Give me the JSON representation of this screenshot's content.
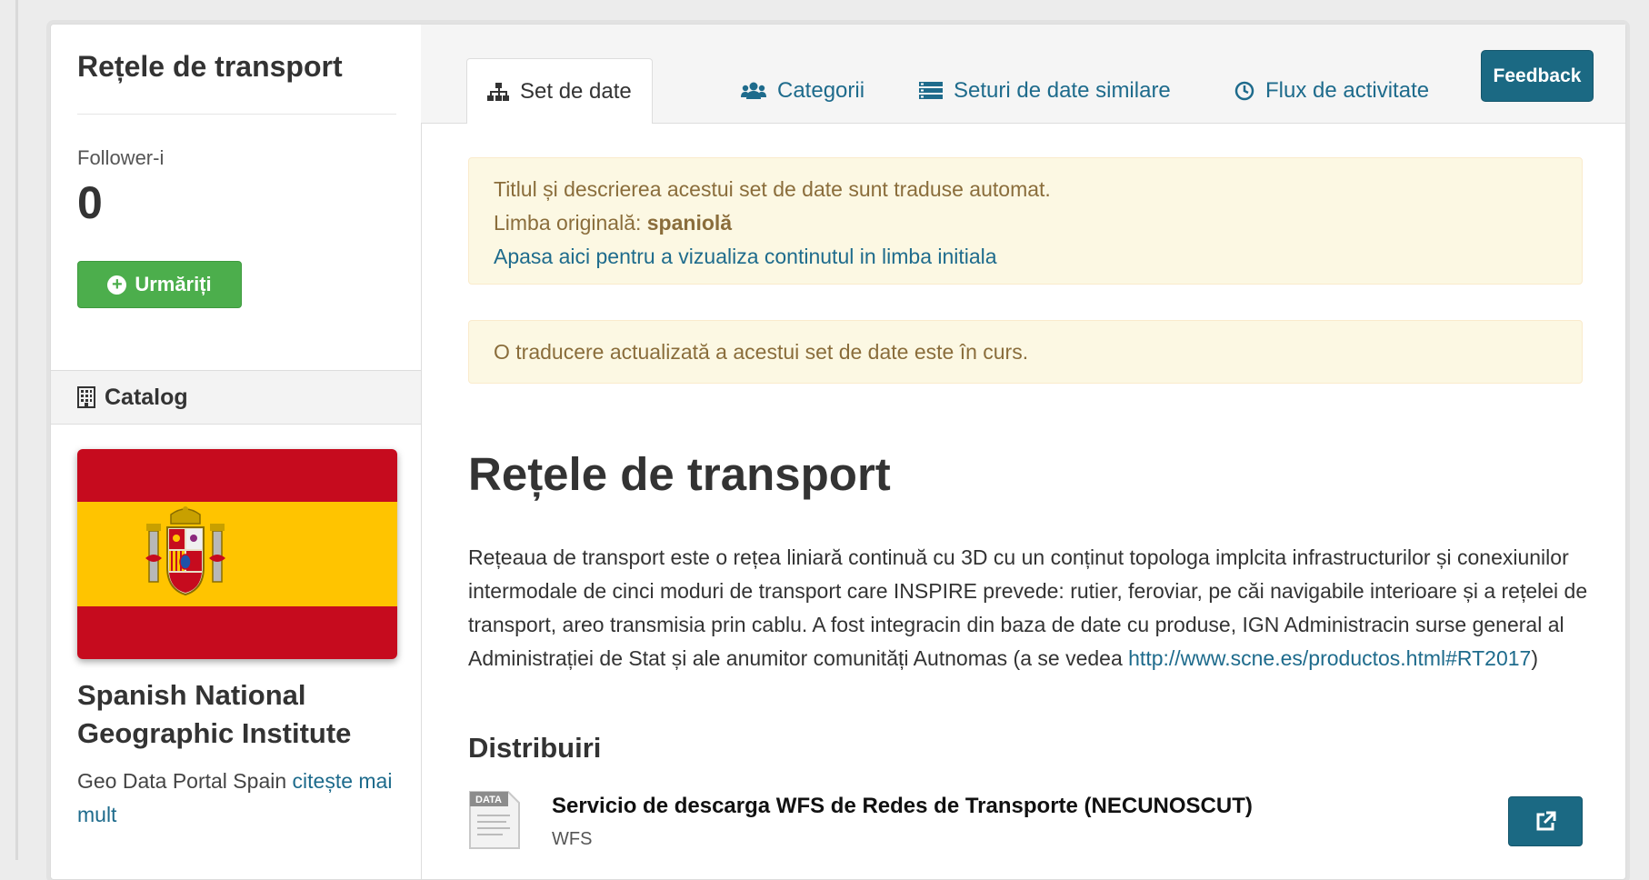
{
  "sidebar": {
    "title": "Rețele de transport",
    "followers_label": "Follower-i",
    "followers_count": "0",
    "follow_button": "Urmăriți",
    "catalog_label": "Catalog",
    "publisher_name": "Spanish National Geographic Institute",
    "publisher_desc": "Geo Data Portal Spain",
    "read_more": "citește mai mult"
  },
  "tabs": [
    {
      "label": "Set de date",
      "icon": "sitemap-icon",
      "active": true
    },
    {
      "label": "Categorii",
      "icon": "users-icon",
      "active": false
    },
    {
      "label": "Seturi de date similare",
      "icon": "list-icon",
      "active": false
    },
    {
      "label": "Flux de activitate",
      "icon": "clock-icon",
      "active": false
    }
  ],
  "feedback_button": "Feedback",
  "translation_alert": {
    "line1": "Titlul și descrierea acestui set de date sunt traduse automat.",
    "line2_prefix": "Limba originală: ",
    "line2_lang": "spaniolă",
    "link": "Apasa aici pentru a vizualiza continutul in limba initiala"
  },
  "update_alert": "O traducere actualizată a acestui set de date este în curs.",
  "dataset": {
    "title": "Rețele de transport",
    "description": "Rețeaua de transport este o rețea liniară continuă cu 3D cu un conținut topologa implcita infrastructurilor și conexiunilor intermodale de cinci moduri de transport care INSPIRE prevede: rutier, feroviar, pe căi navigabile interioare și a rețelei de transport, areo transmisia prin cablu. A fost integracin din baza de date cu produse, IGN Administracin surse general al Administrației de Stat și ale anumitor comunități Autnomas (a se vedea ",
    "description_link": "http://www.scne.es/productos.html#RT2017",
    "description_suffix": ")"
  },
  "distributions": {
    "title": "Distribuiri",
    "items": [
      {
        "name": "Servicio de descarga WFS de Redes de Transporte (NECUNOSCUT)",
        "format": "WFS",
        "icon_label": "DATA"
      }
    ]
  },
  "colors": {
    "follow_green": "#4cae4c",
    "primary_blue": "#1b6983",
    "link_blue": "#1e6b8c",
    "alert_bg": "#fcf8e3",
    "alert_text": "#8a6d3b",
    "flag_red": "#c60b1e",
    "flag_yellow": "#ffc400"
  }
}
